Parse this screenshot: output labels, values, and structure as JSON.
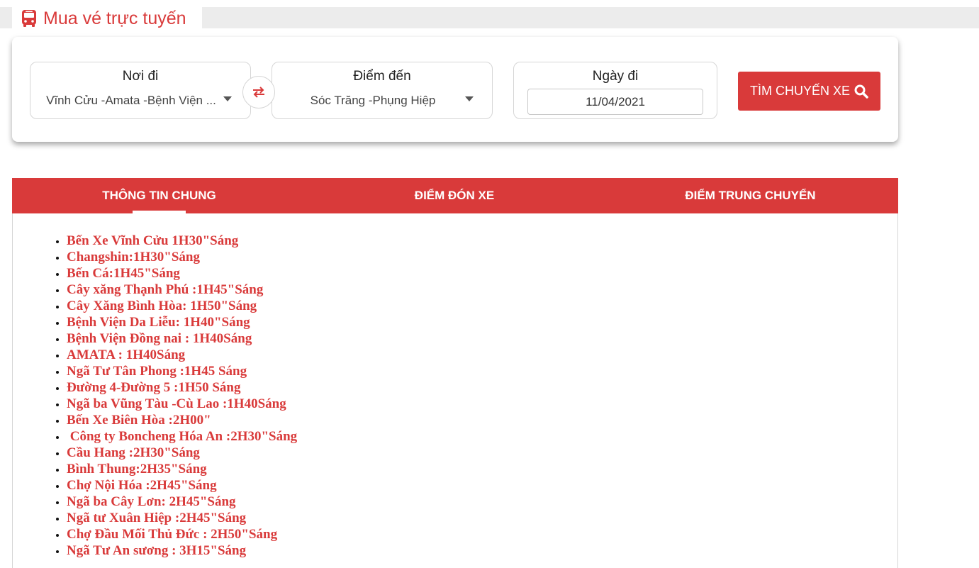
{
  "header": {
    "title": "Mua vé trực tuyến",
    "icon": "bus-icon",
    "accent_color": "#d93a3a"
  },
  "search": {
    "origin_label": "Nơi đi",
    "origin_value": "Vĩnh Cửu -Amata -Bệnh Viện ...",
    "destination_label": "Điểm đến",
    "destination_value": "Sóc Trăng -Phụng Hiệp",
    "date_label": "Ngày đi",
    "date_value": "11/04/2021",
    "button_label": "TÌM CHUYẾN XE",
    "swap_icon": "swap-icon",
    "search_icon": "search-icon"
  },
  "tabs": [
    {
      "label": "THÔNG TIN CHUNG",
      "active": true
    },
    {
      "label": "ĐIỂM ĐÓN XE",
      "active": false
    },
    {
      "label": "ĐIỂM TRUNG CHUYỂN",
      "active": false
    }
  ],
  "stops": [
    "Bến Xe Vĩnh Cửu 1H30\"Sáng",
    "Changshin:1H30\"Sáng",
    "Bến Cá:1H45\"Sáng",
    "Cây xăng Thạnh Phú :1H45\"Sáng",
    "Cây Xăng Bình Hòa: 1H50\"Sáng",
    "Bệnh Viện Da Liễu: 1H40\"Sáng",
    "Bệnh Viện Đồng nai : 1H40Sáng",
    "AMATA : 1H40Sáng",
    "Ngã Tư Tân Phong :1H45 Sáng",
    "Đường 4-Đường 5 :1H50 Sáng",
    "Ngã ba Vũng Tàu -Cù Lao :1H40Sáng",
    "Bến Xe Biên Hòa :2H00\"",
    " Công ty Boncheng Hóa An :2H30\"Sáng",
    "Cầu Hang :2H30\"Sáng",
    "Bình Thung:2H35\"Sáng",
    "Chợ Nội Hóa :2H45\"Sáng",
    "Ngã ba Cây Lơn: 2H45\"Sáng",
    "Ngã tư Xuân Hiệp :2H45\"Sáng",
    "Chợ Đầu Mối Thủ Đức : 2H50\"Sáng",
    "Ngã Tư An sương : 3H15\"Sáng"
  ]
}
